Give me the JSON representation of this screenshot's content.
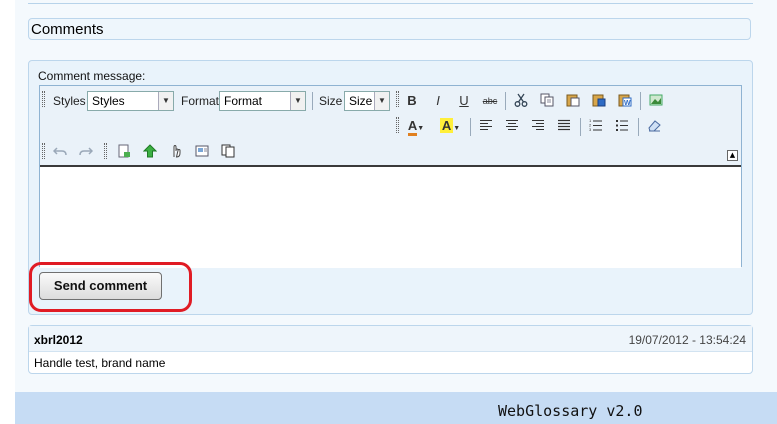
{
  "section": {
    "title": "Comments"
  },
  "form": {
    "label": "Comment message:",
    "send_label": "Send comment"
  },
  "toolbar": {
    "styles_label": "Styles",
    "styles_value": "Styles",
    "format_label": "Format",
    "format_value": "Format",
    "size_label": "Size",
    "size_value": "Size",
    "bold": "B",
    "italic": "I",
    "underline": "U",
    "strike": "abc",
    "text_color": "A",
    "bg_color": "A"
  },
  "comment": {
    "author": "xbrl2012",
    "date": "19/07/2012 - 13:54:24",
    "text": "Handle test, brand name"
  },
  "footer": {
    "text": "WebGlossary v2.0"
  },
  "colors": {
    "accent_red": "#e01b24",
    "panel_border": "#bcd6ec",
    "footer_bg": "#c6dcf4"
  },
  "icons": [
    "cut-icon",
    "copy-icon",
    "paste-icon",
    "paste-text-icon",
    "paste-word-icon",
    "image-icon",
    "align-left-icon",
    "align-center-icon",
    "align-right-icon",
    "align-justify-icon",
    "numbered-list-icon",
    "bullet-list-icon",
    "eraser-icon",
    "undo-icon",
    "redo-icon",
    "new-page-icon",
    "upload-icon",
    "hand-icon",
    "insert-icon",
    "copy-format-icon"
  ]
}
